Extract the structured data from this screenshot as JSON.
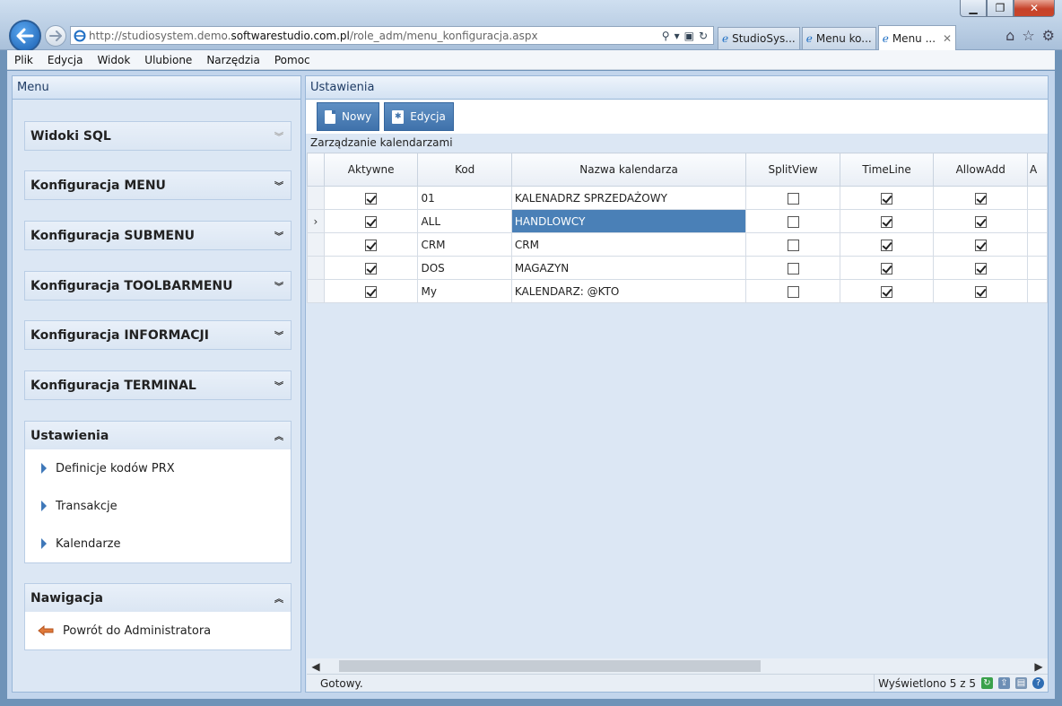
{
  "browser": {
    "url_prefix": "http://studiosystem.demo.",
    "url_domain": "softwarestudio.com.pl",
    "url_path": "/role_adm/menu_konfiguracja.aspx",
    "tabs": [
      {
        "label": "StudioSys...",
        "active": false
      },
      {
        "label": "Menu ko...",
        "active": false
      },
      {
        "label": "Menu ...",
        "active": true
      }
    ],
    "menu": [
      "Plik",
      "Edycja",
      "Widok",
      "Ulubione",
      "Narzędzia",
      "Pomoc"
    ]
  },
  "left": {
    "header": "Menu",
    "sections": [
      {
        "title": "Widoki SQL",
        "expanded": false
      },
      {
        "title": "Konfiguracja MENU",
        "expanded": false
      },
      {
        "title": "Konfiguracja SUBMENU",
        "expanded": false
      },
      {
        "title": "Konfiguracja TOOLBARMENU",
        "expanded": false
      },
      {
        "title": "Konfiguracja INFORMACJI",
        "expanded": false
      },
      {
        "title": "Konfiguracja TERMINAL",
        "expanded": false
      }
    ],
    "settings": {
      "title": "Ustawienia",
      "items": [
        "Definicje kodów PRX",
        "Transakcje",
        "Kalendarze"
      ]
    },
    "navigation": {
      "title": "Nawigacja",
      "items": [
        "Powrót do Administratora"
      ]
    }
  },
  "right": {
    "header": "Ustawienia",
    "toolbar": {
      "new_label": "Nowy",
      "edit_label": "Edycja"
    },
    "caption": "Zarządzanie kalendarzami",
    "columns": [
      "Aktywne",
      "Kod",
      "Nazwa kalendarza",
      "SplitView",
      "TimeLine",
      "AllowAdd",
      "A"
    ],
    "rows": [
      {
        "current": false,
        "aktywne": true,
        "kod": "01",
        "nazwa": "KALENADRZ SPRZEDAŻOWY",
        "splitview": false,
        "timeline": true,
        "allowadd": true
      },
      {
        "current": true,
        "aktywne": true,
        "kod": "ALL",
        "nazwa": "HANDLOWCY",
        "splitview": false,
        "timeline": true,
        "allowadd": true
      },
      {
        "current": false,
        "aktywne": true,
        "kod": "CRM",
        "nazwa": "CRM",
        "splitview": false,
        "timeline": true,
        "allowadd": true
      },
      {
        "current": false,
        "aktywne": true,
        "kod": "DOS",
        "nazwa": "MAGAZYN",
        "splitview": false,
        "timeline": true,
        "allowadd": true
      },
      {
        "current": false,
        "aktywne": true,
        "kod": "My",
        "nazwa": "KALENDARZ: @KTO",
        "splitview": false,
        "timeline": true,
        "allowadd": true
      }
    ],
    "current_row_marker": "›",
    "status_left": "Gotowy.",
    "status_right": "Wyświetlono 5 z 5"
  },
  "colors": {
    "selection": "#4a80b7",
    "button": "#3f72ab",
    "accent_header": "#1e3b64"
  }
}
